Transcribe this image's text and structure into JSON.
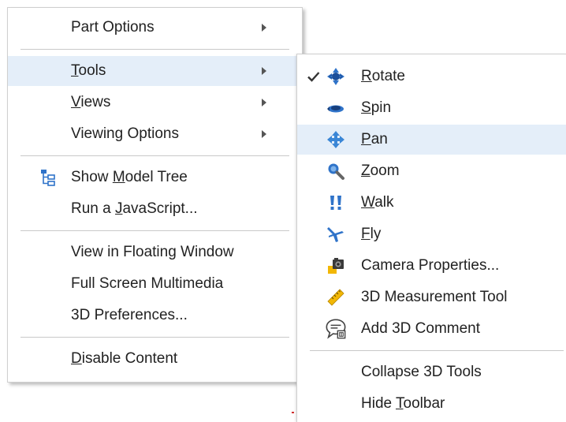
{
  "main_menu": {
    "part_options": {
      "label": "Part Options"
    },
    "tools": {
      "pre": "",
      "mn": "T",
      "post": "ools"
    },
    "views": {
      "pre": "",
      "mn": "V",
      "post": "iews"
    },
    "viewing_options": {
      "label": "Viewing Options"
    },
    "show_model_tree": {
      "pre": "Show ",
      "mn": "M",
      "post": "odel Tree",
      "icon": "model-tree-icon"
    },
    "run_javascript": {
      "pre": "Run a ",
      "mn": "J",
      "post": "avaScript..."
    },
    "view_floating": {
      "label": "View in Floating Window"
    },
    "full_screen": {
      "label": "Full Screen Multimedia"
    },
    "preferences": {
      "label": "3D Preferences..."
    },
    "disable_content": {
      "pre": "",
      "mn": "D",
      "post": "isable Content"
    }
  },
  "tools_submenu": {
    "rotate": {
      "pre": "",
      "mn": "R",
      "post": "otate",
      "icon": "rotate-icon",
      "checked": true
    },
    "spin": {
      "pre": "",
      "mn": "S",
      "post": "pin",
      "icon": "spin-icon"
    },
    "pan": {
      "pre": "",
      "mn": "P",
      "post": "an",
      "icon": "pan-icon"
    },
    "zoom": {
      "pre": "",
      "mn": "Z",
      "post": "oom",
      "icon": "zoom-icon"
    },
    "walk": {
      "pre": "",
      "mn": "W",
      "post": "alk",
      "icon": "walk-icon"
    },
    "fly": {
      "pre": "",
      "mn": "F",
      "post": "ly",
      "icon": "fly-icon"
    },
    "camera_properties": {
      "label": "Camera Properties...",
      "icon": "camera-icon"
    },
    "measurement_tool": {
      "label": "3D Measurement Tool",
      "icon": "ruler-icon"
    },
    "add_comment": {
      "label": "Add 3D Comment",
      "icon": "comment-icon"
    },
    "collapse_tools": {
      "label": "Collapse 3D Tools"
    },
    "hide_toolbar": {
      "pre": "Hide ",
      "mn": "T",
      "post": "oolbar"
    }
  },
  "colors": {
    "highlight": "#e4eef9",
    "accent_blue": "#2f73c9",
    "text": "#222222"
  }
}
